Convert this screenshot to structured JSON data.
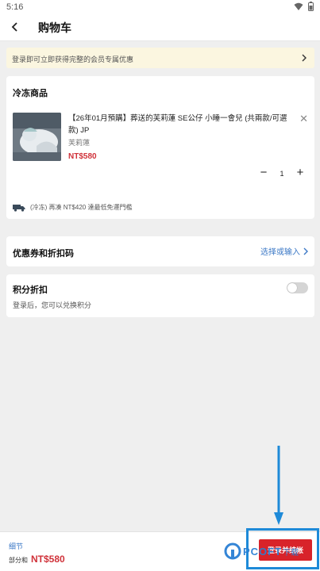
{
  "statusbar": {
    "time": "5:16"
  },
  "header": {
    "title": "购物车"
  },
  "banner": {
    "text": "登录即可立即获得完整的会员专属优惠"
  },
  "cart": {
    "section_title": "冷冻商品",
    "item": {
      "name": "【26年01月預購】葬送的芙莉蓮 SE公仔 小睡一會兒 (共兩款/可選款) JP",
      "variant": "芙莉蓮",
      "price": "NT$580",
      "quantity": "1"
    },
    "shipping_note": "(冷冻) 再凑 NT$420 達最低免運門檻"
  },
  "coupon": {
    "label": "优惠券和折扣码",
    "action": "选择或输入"
  },
  "points": {
    "label": "积分折扣",
    "hint": "登录后，您可以兑换积分"
  },
  "footer": {
    "details_label": "细节",
    "total_label": "部分和",
    "total_amount": "NT$580",
    "checkout_label": "登录并结帐"
  },
  "watermark": {
    "text": "PCOFT",
    "suffix": "下载"
  },
  "colors": {
    "price_red": "#d0323a",
    "link_blue": "#3b78c6",
    "checkout_red": "#d8232a",
    "highlight_blue": "#1e8ad8"
  }
}
